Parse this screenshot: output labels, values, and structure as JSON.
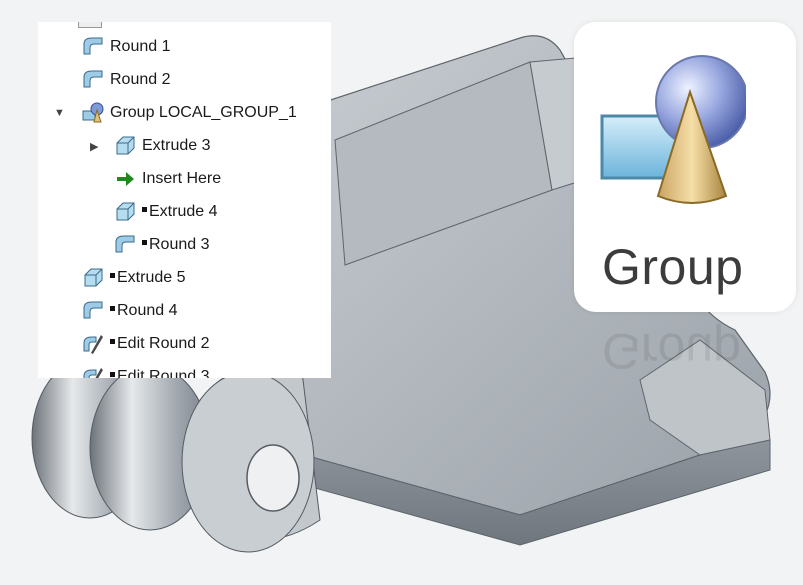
{
  "model_tree": {
    "items": [
      {
        "label": "Round 1",
        "icon": "round-feature-icon"
      },
      {
        "label": "Round 2",
        "icon": "round-feature-icon"
      },
      {
        "label": "Group LOCAL_GROUP_1",
        "icon": "group-feature-icon",
        "expanded": true
      },
      {
        "label": "Extrude 3",
        "icon": "extrude-feature-icon",
        "collapsed": true
      },
      {
        "label": "Insert Here",
        "icon": "insert-here-arrow-icon"
      },
      {
        "label": "Extrude 4",
        "icon": "extrude-feature-icon"
      },
      {
        "label": "Round 3",
        "icon": "round-feature-icon"
      },
      {
        "label": "Extrude 5",
        "icon": "extrude-feature-icon"
      },
      {
        "label": "Round 4",
        "icon": "round-feature-icon"
      },
      {
        "label": "Edit Round 2",
        "icon": "edit-round-icon"
      },
      {
        "label": "Edit Round 3",
        "icon": "edit-round-icon"
      }
    ]
  },
  "group_command": {
    "label": "Group",
    "icon": "group-icon"
  },
  "colors": {
    "part_surface": "#a9afb6",
    "part_dark": "#7d848c",
    "insert_arrow": "#1e8a1e",
    "tree_bg": "#ffffff"
  }
}
